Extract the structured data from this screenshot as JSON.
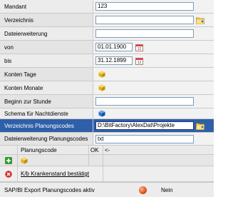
{
  "rows": {
    "mandant": {
      "label": "Mandant",
      "value": "123"
    },
    "verzeichnis": {
      "label": "Verzeichnis",
      "value": ""
    },
    "dateierweiterung": {
      "label": "Dateierweiterung",
      "value": ""
    },
    "von": {
      "label": "von",
      "value": "01.01.1900"
    },
    "bis": {
      "label": "bis",
      "value": "31.12.1899"
    },
    "konten_tage": {
      "label": "Konten Tage"
    },
    "konten_monate": {
      "label": "Konten Monate"
    },
    "beginn_zur_stunde": {
      "label": "Beginn zur Stunde",
      "value": ""
    },
    "schema_nachtdienste": {
      "label": "Schema für Nachtdienste"
    },
    "verzeichnis_planungscodes": {
      "label": "Verzeichnis Planungscodes",
      "value": "D:\\BitFactory\\AlexDat\\Projekte"
    },
    "dateierweiterung_planungscodes": {
      "label": "Dateierweiterung Planungscodes",
      "value": "txt"
    }
  },
  "table": {
    "headers": {
      "planungscode": "Planungscode",
      "ok": "OK",
      "arrow": "<-"
    },
    "rows": [
      {
        "text": "K/b Krankenstand bestätigt"
      }
    ]
  },
  "status": {
    "label": "SAP/BI Export Planungscodes aktiv",
    "value": "Nein"
  },
  "colors": {
    "selection": "#2f5fa8",
    "add_icon": "#2e9b2e",
    "delete_icon": "#d62b2b",
    "status_ball": "#e0511c"
  }
}
